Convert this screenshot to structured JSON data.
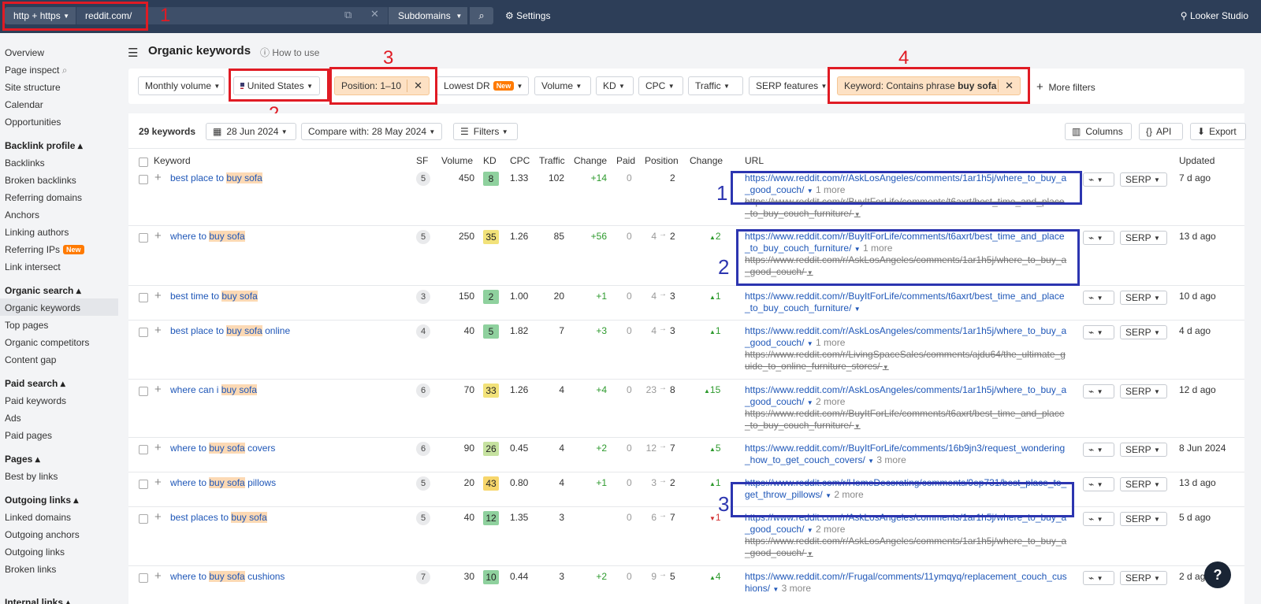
{
  "topbar": {
    "protocol": "http + https",
    "domain": "reddit.com/",
    "mode": "Subdomains",
    "settings": "Settings",
    "looker": "Looker Studio"
  },
  "annotations": {
    "red": [
      "1",
      "2",
      "3",
      "4"
    ],
    "blue": [
      "1",
      "2",
      "3"
    ]
  },
  "sidebar": {
    "items": [
      "Overview",
      "Page inspect",
      "Site structure",
      "Calendar",
      "Opportunities"
    ],
    "backlink_head": "Backlink profile ▴",
    "backlink": [
      "Backlinks",
      "Broken backlinks",
      "Referring domains",
      "Anchors",
      "Linking authors",
      "Referring IPs",
      "Link intersect"
    ],
    "new_badge": "New",
    "organic_head": "Organic search ▴",
    "organic": [
      "Organic keywords",
      "Top pages",
      "Organic competitors",
      "Content gap"
    ],
    "paid_head": "Paid search ▴",
    "paid": [
      "Paid keywords",
      "Ads",
      "Paid pages"
    ],
    "pages_head": "Pages ▴",
    "pages": [
      "Best by links"
    ],
    "outgoing_head": "Outgoing links ▴",
    "outgoing": [
      "Linked domains",
      "Outgoing anchors",
      "Outgoing links",
      "Broken links"
    ],
    "cut_head": "Internal links ▴"
  },
  "page": {
    "title": "Organic keywords",
    "howto": "How to use"
  },
  "filters": {
    "monthly": "Monthly volume",
    "country": "United States",
    "position": "Position: 1–10",
    "lowest_dr": "Lowest DR",
    "volume": "Volume",
    "kd": "KD",
    "cpc": "CPC",
    "traffic": "Traffic",
    "serp": "SERP features",
    "keyword_prefix": "Keyword: Contains phrase ",
    "keyword_term": "buy sofa",
    "more": "More filters"
  },
  "toolbar": {
    "count": "29 keywords",
    "date": "28 Jun 2024",
    "compare": "Compare with: 28 May 2024",
    "filters": "Filters",
    "columns": "Columns",
    "api": "API",
    "export": "Export"
  },
  "headers": {
    "keyword": "Keyword",
    "sf": "SF",
    "volume": "Volume",
    "kd": "KD",
    "cpc": "CPC",
    "traffic": "Traffic",
    "change": "Change",
    "paid": "Paid",
    "position": "Position",
    "change2": "Change",
    "url": "URL",
    "updated": "Updated"
  },
  "colors": {
    "kd_green": "#8fd19e",
    "kd_yellow": "#f2e27a",
    "kd_lightgreen": "#c6e2a0",
    "kd_orange": "#f7d66b"
  },
  "rows": [
    {
      "kw_pre": "best place to ",
      "kw_hl": "buy sofa",
      "kw_post": "",
      "sf": "5",
      "volume": "450",
      "kd": "8",
      "kd_color": "#8fd19e",
      "cpc": "1.33",
      "traffic": "102",
      "change": "+14",
      "paid": "0",
      "pos_from": "",
      "pos": "2",
      "pchange": "",
      "pdir": "",
      "url": "https://www.reddit.com/r/AskLosAngeles/comments/1ar1h5j/where_to_buy_a_good_couch/",
      "url_more": "1 more",
      "url2": "https://www.reddit.com/r/BuyItForLife/comments/t6axrt/best_time_and_place_to_buy_couch_furniture/",
      "updated": "7 d ago"
    },
    {
      "kw_pre": "where to ",
      "kw_hl": "buy sofa",
      "kw_post": "",
      "sf": "5",
      "volume": "250",
      "kd": "35",
      "kd_color": "#f2e27a",
      "cpc": "1.26",
      "traffic": "85",
      "change": "+56",
      "paid": "0",
      "pos_from": "4",
      "pos": "2",
      "pchange": "2",
      "pdir": "up",
      "url": "https://www.reddit.com/r/BuyItForLife/comments/t6axrt/best_time_and_place_to_buy_couch_furniture/",
      "url_more": "1 more",
      "url2": "https://www.reddit.com/r/AskLosAngeles/comments/1ar1h5j/where_to_buy_a_good_couch/",
      "updated": "13 d ago"
    },
    {
      "kw_pre": "best time to ",
      "kw_hl": "buy sofa",
      "kw_post": "",
      "sf": "3",
      "volume": "150",
      "kd": "2",
      "kd_color": "#8fd19e",
      "cpc": "1.00",
      "traffic": "20",
      "change": "+1",
      "paid": "0",
      "pos_from": "4",
      "pos": "3",
      "pchange": "1",
      "pdir": "up",
      "url": "https://www.reddit.com/r/BuyItForLife/comments/t6axrt/best_time_and_place_to_buy_couch_furniture/",
      "url_more": "",
      "url2": "",
      "updated": "10 d ago"
    },
    {
      "kw_pre": "best place to ",
      "kw_hl": "buy sofa",
      "kw_post": " online",
      "sf": "4",
      "volume": "40",
      "kd": "5",
      "kd_color": "#8fd19e",
      "cpc": "1.82",
      "traffic": "7",
      "change": "+3",
      "paid": "0",
      "pos_from": "4",
      "pos": "3",
      "pchange": "1",
      "pdir": "up",
      "url": "https://www.reddit.com/r/AskLosAngeles/comments/1ar1h5j/where_to_buy_a_good_couch/",
      "url_more": "1 more",
      "url2": "https://www.reddit.com/r/LivingSpaceSales/comments/ajdu64/the_ultimate_guide_to_online_furniture_stores/",
      "updated": "4 d ago"
    },
    {
      "kw_pre": "where can i ",
      "kw_hl": "buy sofa",
      "kw_post": "",
      "sf": "6",
      "volume": "70",
      "kd": "33",
      "kd_color": "#f2e27a",
      "cpc": "1.26",
      "traffic": "4",
      "change": "+4",
      "paid": "0",
      "pos_from": "23",
      "pos": "8",
      "pchange": "15",
      "pdir": "up",
      "url": "https://www.reddit.com/r/AskLosAngeles/comments/1ar1h5j/where_to_buy_a_good_couch/",
      "url_more": "2 more",
      "url2": "https://www.reddit.com/r/BuyItForLife/comments/t6axrt/best_time_and_place_to_buy_couch_furniture/",
      "updated": "12 d ago"
    },
    {
      "kw_pre": "where to ",
      "kw_hl": "buy sofa",
      "kw_post": " covers",
      "sf": "6",
      "volume": "90",
      "kd": "26",
      "kd_color": "#c6e2a0",
      "cpc": "0.45",
      "traffic": "4",
      "change": "+2",
      "paid": "0",
      "pos_from": "12",
      "pos": "7",
      "pchange": "5",
      "pdir": "up",
      "url": "https://www.reddit.com/r/BuyItForLife/comments/16b9jn3/request_wondering_how_to_get_couch_covers/",
      "url_more": "3 more",
      "url2": "",
      "updated": "8 Jun 2024"
    },
    {
      "kw_pre": "where to ",
      "kw_hl": "buy sofa",
      "kw_post": " pillows",
      "sf": "5",
      "volume": "20",
      "kd": "43",
      "kd_color": "#f7d66b",
      "cpc": "0.80",
      "traffic": "4",
      "change": "+1",
      "paid": "0",
      "pos_from": "3",
      "pos": "2",
      "pchange": "1",
      "pdir": "up",
      "url": "https://www.reddit.com/r/HomeDecorating/comments/9ep731/best_place_to_get_throw_pillows/",
      "url_more": "2 more",
      "url2": "",
      "updated": "13 d ago"
    },
    {
      "kw_pre": "best places to ",
      "kw_hl": "buy sofa",
      "kw_post": "",
      "sf": "5",
      "volume": "40",
      "kd": "12",
      "kd_color": "#8fd19e",
      "cpc": "1.35",
      "traffic": "3",
      "change": "",
      "paid": "0",
      "pos_from": "6",
      "pos": "7",
      "pchange": "1",
      "pdir": "down",
      "url": "https://www.reddit.com/r/AskLosAngeles/comments/1ar1h5j/where_to_buy_a_good_couch/",
      "url_more": "2 more",
      "url2": "https://www.reddit.com/r/AskLosAngeles/comments/1ar1h5j/where_to_buy_a_good_couch/",
      "updated": "5 d ago"
    },
    {
      "kw_pre": "where to ",
      "kw_hl": "buy sofa",
      "kw_post": " cushions",
      "sf": "7",
      "volume": "30",
      "kd": "10",
      "kd_color": "#8fd19e",
      "cpc": "0.44",
      "traffic": "3",
      "change": "+2",
      "paid": "0",
      "pos_from": "9",
      "pos": "5",
      "pchange": "4",
      "pdir": "up",
      "url": "https://www.reddit.com/r/Frugal/comments/11ymqyq/replacement_couch_cushions/",
      "url_more": "3 more",
      "url2": "",
      "updated": "2 d ago"
    }
  ],
  "row_buttons": {
    "chart": "⌁",
    "serp": "SERP"
  },
  "help": "?"
}
